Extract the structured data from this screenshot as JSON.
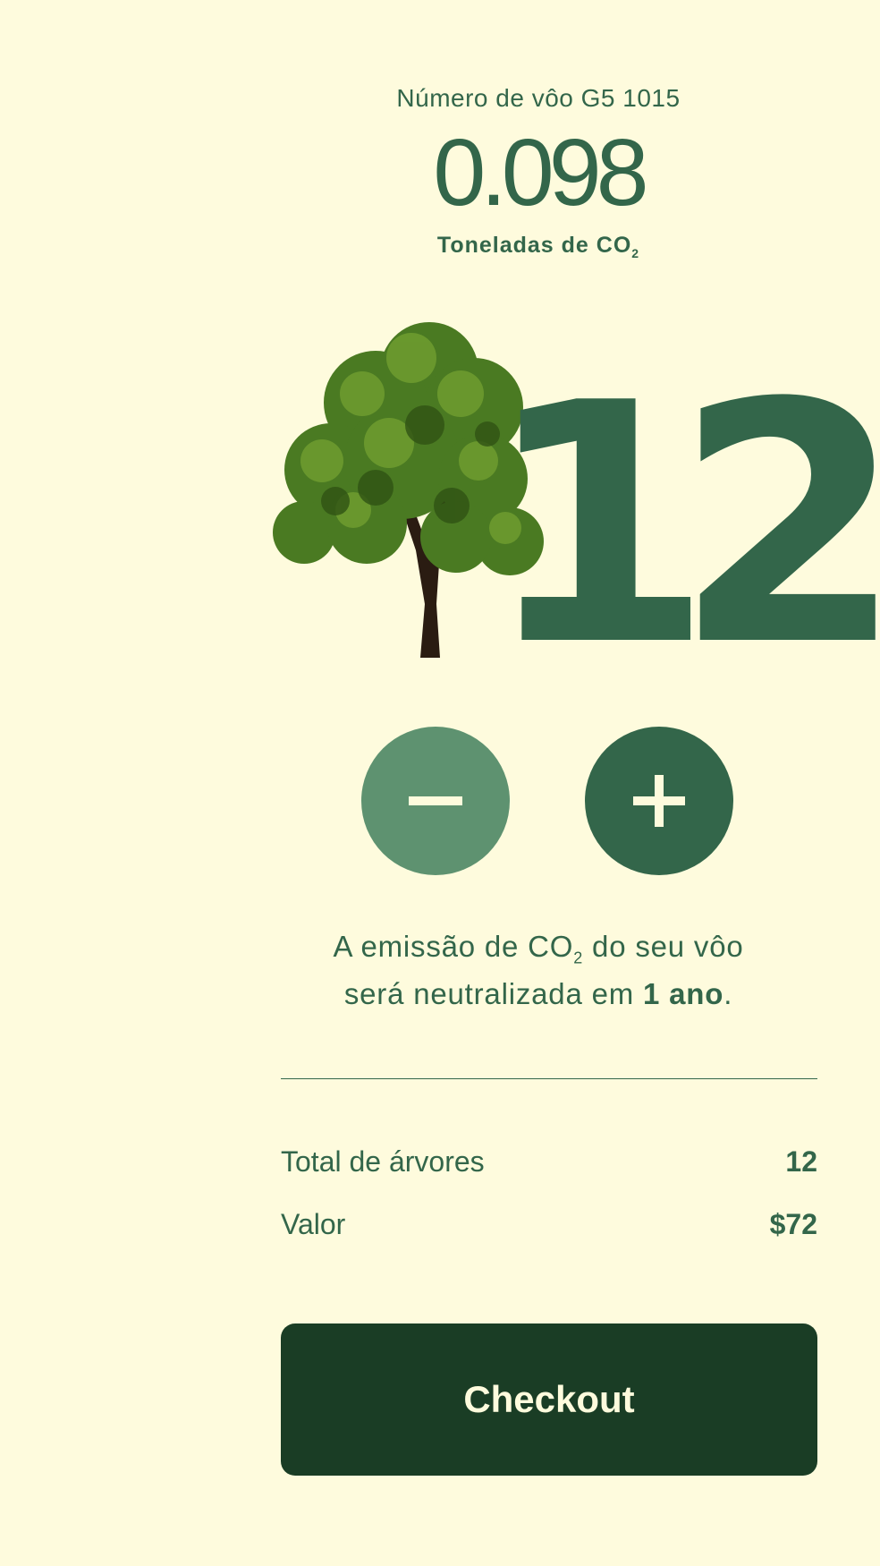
{
  "flight": {
    "label": "Número de vôo G5 1015"
  },
  "emission": {
    "value": "0.098",
    "unit_prefix": "Toneladas de CO",
    "unit_sub": "2"
  },
  "trees": {
    "count": "12"
  },
  "stepper": {
    "minus_icon": "minus-icon",
    "plus_icon": "plus-icon"
  },
  "neutralization": {
    "line1_prefix": "A emissão de CO",
    "sub": "2",
    "line1_suffix": " do seu vôo",
    "line2_prefix": "será neutralizada em ",
    "duration": "1 ano",
    "line2_suffix": "."
  },
  "summary": {
    "total_label": "Total de árvores",
    "total_value": "12",
    "price_label": "Valor",
    "price_value": "$72"
  },
  "checkout": {
    "label": "Checkout"
  },
  "colors": {
    "background": "#fefbdd",
    "primary": "#33664a",
    "minus_button": "#5e9270",
    "checkout_button": "#1a3d25"
  }
}
